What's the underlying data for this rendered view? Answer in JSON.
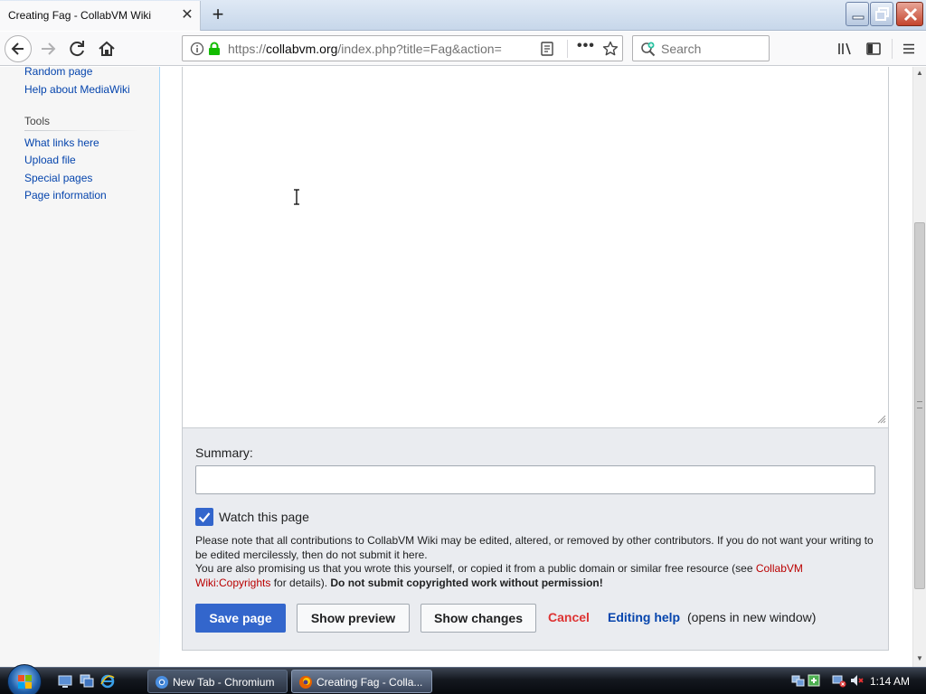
{
  "browser": {
    "tab_title": "Creating Fag - CollabVM Wiki",
    "url_domain": "collabvm.org",
    "url_rest": "/index.php?title=Fag&action=",
    "url_scheme": "https://",
    "search_placeholder": "Search"
  },
  "sidebar": {
    "nav_links": [
      {
        "label": "Random page"
      },
      {
        "label": "Help about MediaWiki"
      }
    ],
    "tools_heading": "Tools",
    "tools_links": [
      {
        "label": "What links here"
      },
      {
        "label": "Upload file"
      },
      {
        "label": "Special pages"
      },
      {
        "label": "Page information"
      }
    ]
  },
  "editor": {
    "summary_label": "Summary:",
    "summary_value": "",
    "watch_label": "Watch this page",
    "watch_checked": true,
    "notice_line1": "Please note that all contributions to CollabVM Wiki may be edited, altered, or removed by other contributors. If you do not want your writing to be edited mercilessly, then do not submit it here.",
    "notice_line2_pre": "You are also promising us that you wrote this yourself, or copied it from a public domain or similar free resource (see ",
    "notice_link": "CollabVM Wiki:Copyrights",
    "notice_line2_mid": " for details). ",
    "notice_bold": "Do not submit copyrighted work without permission!",
    "save_label": "Save page",
    "preview_label": "Show preview",
    "changes_label": "Show changes",
    "cancel_label": "Cancel",
    "help_label": "Editing help",
    "help_note": "(opens in new window)"
  },
  "taskbar": {
    "tasks": [
      {
        "label": "New Tab - Chromium"
      },
      {
        "label": "Creating Fag - Colla..."
      }
    ],
    "clock": "1:14 AM"
  },
  "colors": {
    "link": "#0645ad",
    "primary_button": "#3366cc",
    "cancel": "#dd3333",
    "copyright_link": "#ba0000"
  }
}
